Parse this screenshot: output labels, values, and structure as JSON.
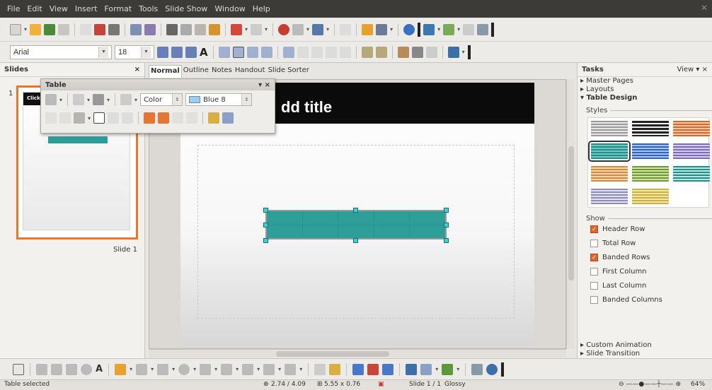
{
  "menu": [
    "File",
    "Edit",
    "View",
    "Insert",
    "Format",
    "Tools",
    "Slide Show",
    "Window",
    "Help"
  ],
  "formatting": {
    "font_name": "Arial",
    "font_size": "18"
  },
  "slides_pane": {
    "title": "Slides",
    "close": "×",
    "slide_number": "1",
    "slide_label": "Slide 1",
    "thumb_text": "Click"
  },
  "view_tabs": [
    "Normal",
    "Outline",
    "Notes",
    "Handout",
    "Slide Sorter"
  ],
  "slide": {
    "title": "dd title"
  },
  "table_toolbar": {
    "title": "Table",
    "area_style": "Color",
    "fill_color": "Blue 8",
    "controls": "▾ ×"
  },
  "tasks": {
    "title": "Tasks",
    "view": "View ▾ ×",
    "links": [
      "Master Pages",
      "Layouts"
    ],
    "active": "Table Design",
    "styles_label": "Styles",
    "show_label": "Show",
    "options": [
      {
        "label": "Header Row",
        "checked": true
      },
      {
        "label": "Total Row",
        "checked": false
      },
      {
        "label": "Banded Rows",
        "checked": true
      },
      {
        "label": "First Column",
        "checked": false
      },
      {
        "label": "Last Column",
        "checked": false
      },
      {
        "label": "Banded Columns",
        "checked": false
      }
    ],
    "bottom_links": [
      "Custom Animation",
      "Slide Transition"
    ]
  },
  "status": {
    "selection": "Table selected",
    "position": "2.74 / 4.09",
    "size": "5.55 x 0.76",
    "slide": "Slide 1 / 1",
    "master": "Glossy",
    "zoom": "64%"
  }
}
